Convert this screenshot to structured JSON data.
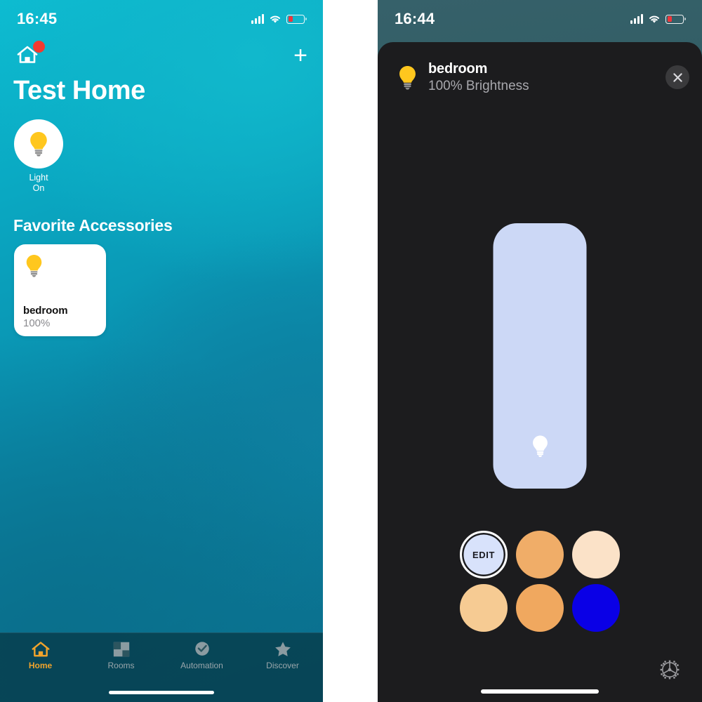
{
  "left_phone": {
    "status_bar": {
      "time": "16:45",
      "signal_icon": "signal-bars-icon",
      "wifi_icon": "wifi-icon",
      "battery_icon": "battery-low-icon",
      "battery_color": "#f0353a"
    },
    "nav": {
      "home_icon": "home-icon",
      "badge_visible": true,
      "badge_color": "#f4392f",
      "add_label": "+"
    },
    "title": "Test Home",
    "scene": {
      "icon": "lightbulb-icon",
      "name": "Light",
      "state": "On"
    },
    "section_title": "Favorite Accessories",
    "accessories": [
      {
        "icon": "lightbulb-icon",
        "name": "bedroom",
        "value": "100%"
      }
    ],
    "tabs": [
      {
        "label": "Home",
        "icon": "home-icon",
        "active": true
      },
      {
        "label": "Rooms",
        "icon": "rooms-icon",
        "active": false
      },
      {
        "label": "Automation",
        "icon": "clock-check-icon",
        "active": false
      },
      {
        "label": "Discover",
        "icon": "star-icon",
        "active": false
      }
    ],
    "accent_color": "#f0a32c",
    "tab_inactive_color": "#9aa6ab"
  },
  "right_phone": {
    "status_bar": {
      "time": "16:44",
      "signal_icon": "signal-bars-icon",
      "wifi_icon": "wifi-icon",
      "battery_icon": "battery-low-icon",
      "battery_color": "#f0353a"
    },
    "sheet": {
      "icon": "lightbulb-icon",
      "title": "bedroom",
      "subtitle": "100% Brightness",
      "close_icon": "close-icon"
    },
    "brightness_slider": {
      "icon": "lightbulb-icon",
      "fill_percent": 100,
      "fill_color": "#ccd8f6"
    },
    "swatches": [
      {
        "name": "edit-swatch",
        "label": "EDIT",
        "color": "#d8e2fb"
      },
      {
        "name": "color-swatch-2",
        "label": "",
        "color": "#f0ad68"
      },
      {
        "name": "color-swatch-3",
        "label": "",
        "color": "#fbe2c8"
      },
      {
        "name": "color-swatch-4",
        "label": "",
        "color": "#f6cb93"
      },
      {
        "name": "color-swatch-5",
        "label": "",
        "color": "#f0a85f"
      },
      {
        "name": "color-swatch-6",
        "label": "",
        "color": "#0a00e6"
      }
    ],
    "settings_icon": "gear-icon"
  }
}
